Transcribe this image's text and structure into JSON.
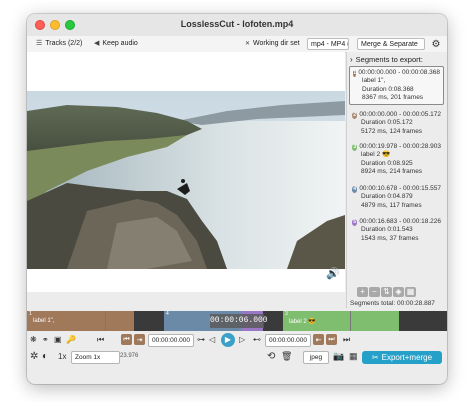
{
  "window": {
    "title": "LosslessCut - lofoten.mp4"
  },
  "toolbar": {
    "tracks_label": "Tracks (2/2)",
    "keep_audio_label": "Keep audio",
    "working_dir_label": "Working dir set",
    "format_value": "mp4 - MP4 (M",
    "merge_mode_value": "Merge & Separate"
  },
  "sidepanel": {
    "header": "Segments to export:",
    "segments": [
      {
        "num": "1",
        "color": "#a0785a",
        "range": "00:00:00.000 - 00:00:08.368",
        "label": "label 1\",",
        "duration": "Duration 0:08.368",
        "frames": "8367 ms, 201 frames"
      },
      {
        "num": "2",
        "color": "#a88a73",
        "range": "00:00:00.000 - 00:00:05.172",
        "label": "",
        "duration": "Duration 0:05.172",
        "frames": "5172 ms, 124 frames"
      },
      {
        "num": "3",
        "color": "#7fbd6f",
        "range": "00:00:19.978 - 00:00:28.903",
        "label": "label 2 😎",
        "duration": "Duration 0:08.925",
        "frames": "8924 ms, 214 frames"
      },
      {
        "num": "4",
        "color": "#6a8aa8",
        "range": "00:00:10.678 - 00:00:15.557",
        "label": "",
        "duration": "Duration 0:04.879",
        "frames": "4879 ms, 117 frames"
      },
      {
        "num": "5",
        "color": "#9a76c6",
        "range": "00:00:16.683 - 00:00:18.226",
        "label": "",
        "duration": "Duration 0:01.543",
        "frames": "1543 ms, 37 frames"
      }
    ],
    "total": "Segments total:   00:00:28.887"
  },
  "timeline": {
    "current_time": "00:00:06.000",
    "seg1_label": "label 1\",",
    "seg1_idx": "1",
    "seg4_idx": "4",
    "seg3_label": "label 2 😎",
    "seg3_idx": "3"
  },
  "controls": {
    "start_time": "00:00:00.000",
    "end_time": "00:00:00.000",
    "speed": "1x",
    "zoom": "Zoom 1x",
    "fps": "23.976",
    "capture_format": "jpeg",
    "export_label": "Export+merge"
  },
  "colors": {
    "accent": "#25a0c8",
    "seg1": "#a0785a",
    "seg3": "#7fbd6f",
    "seg4": "#6a8aa8",
    "seg5": "#9a76c6"
  }
}
